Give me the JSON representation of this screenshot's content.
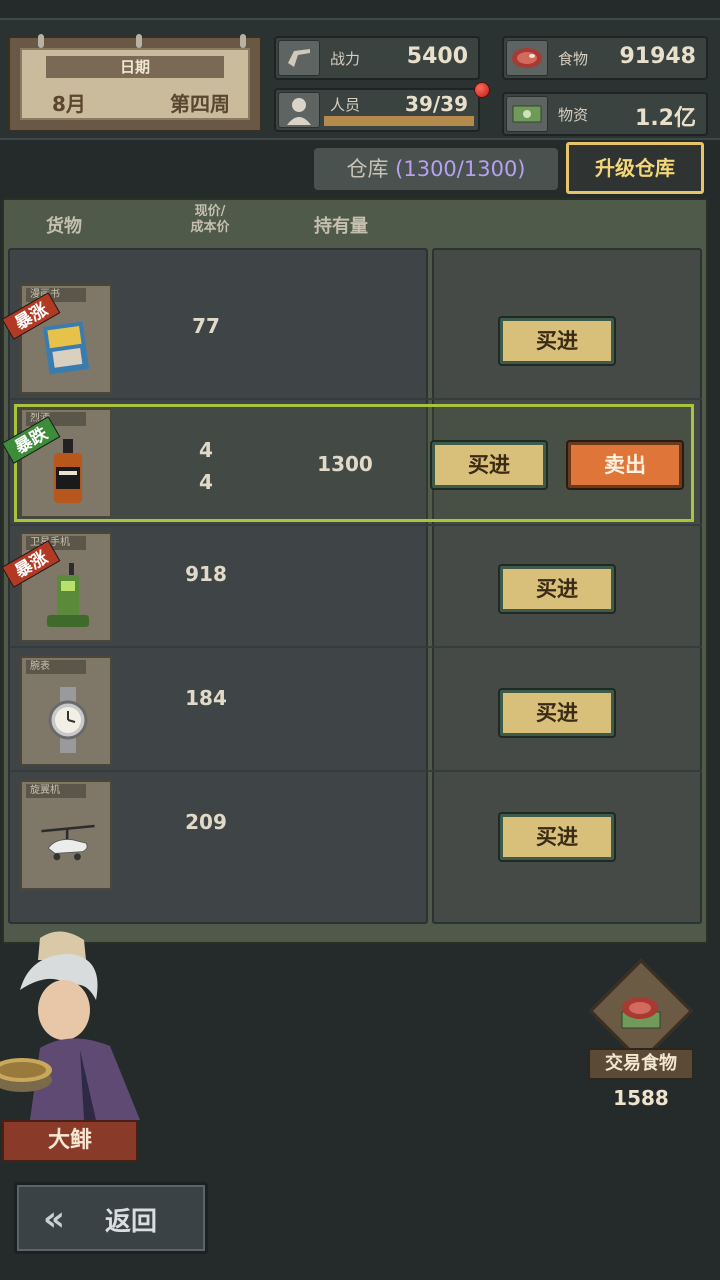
{
  "date": {
    "label": "日期",
    "month": "8月",
    "week": "第四周"
  },
  "stats": {
    "power": {
      "name": "战力",
      "value": "5400",
      "icon": "gun-icon"
    },
    "people": {
      "name": "人员",
      "value": "39/39",
      "fill": 1.0,
      "icon": "person-icon"
    },
    "food": {
      "name": "食物",
      "value": "91948",
      "icon": "meat-icon"
    },
    "supplies": {
      "name": "物资",
      "value": "1.2亿",
      "icon": "cash-icon"
    }
  },
  "warehouse": {
    "label": "仓库",
    "count": "(1300/1300)"
  },
  "upgrade_label": "升级仓库",
  "columns": {
    "goods": "货物",
    "price_line1": "现价/",
    "price_line2": "成本价",
    "holdings": "持有量"
  },
  "items": [
    {
      "name": "漫画书",
      "tag": "暴涨",
      "tag_type": "up",
      "price": "77",
      "cost": "",
      "holding": "",
      "buy": "买进",
      "sell": ""
    },
    {
      "name": "烈酒",
      "tag": "暴跌",
      "tag_type": "down",
      "price": "4",
      "cost": "4",
      "holding": "1300",
      "buy": "买进",
      "sell": "卖出"
    },
    {
      "name": "卫星手机",
      "tag": "暴涨",
      "tag_type": "up",
      "price": "918",
      "cost": "",
      "holding": "",
      "buy": "买进",
      "sell": ""
    },
    {
      "name": "腕表",
      "tag": "",
      "tag_type": "",
      "price": "184",
      "cost": "",
      "holding": "",
      "buy": "买进",
      "sell": ""
    },
    {
      "name": "旋翼机",
      "tag": "",
      "tag_type": "",
      "price": "209",
      "cost": "",
      "holding": "",
      "buy": "买进",
      "sell": ""
    }
  ],
  "merchant": {
    "name": "大鲱"
  },
  "trade": {
    "label": "交易食物",
    "value": "1588"
  },
  "back_label": "返回"
}
